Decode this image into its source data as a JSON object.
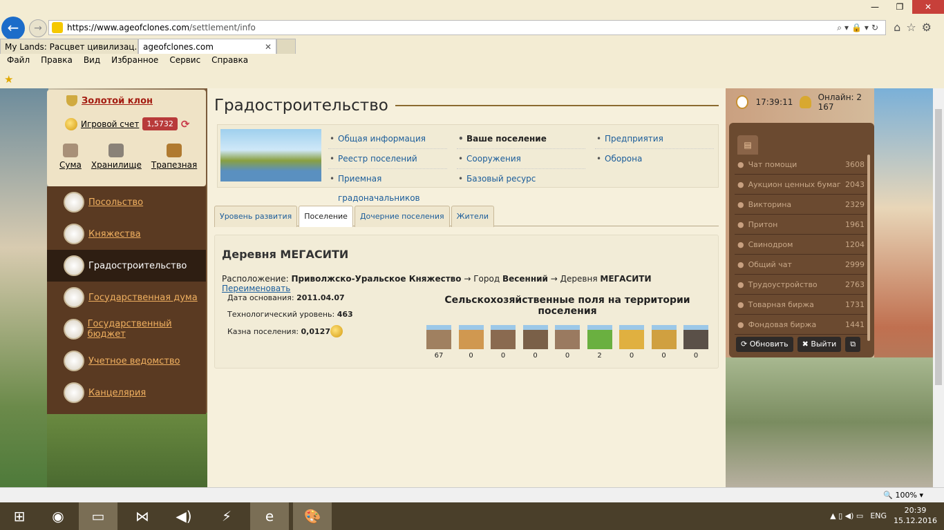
{
  "browser": {
    "url_host": "https://www.ageofclones.com",
    "url_path": "/settlement/info",
    "tabs": [
      {
        "label": "My Lands: Расцвет цивилизац..."
      },
      {
        "label": "ageofclones.com"
      }
    ],
    "menu": [
      "Файл",
      "Правка",
      "Вид",
      "Избранное",
      "Сервис",
      "Справка"
    ],
    "zoom": "100%"
  },
  "left": {
    "gold_clone": "Золотой клон",
    "account_label": "Игровой счет",
    "account_value": "1,5732",
    "quick": [
      {
        "label": "Сума"
      },
      {
        "label": "Хранилище"
      },
      {
        "label": "Трапезная"
      }
    ],
    "nav": [
      {
        "label": "Посольство"
      },
      {
        "label": "Княжества"
      },
      {
        "label": "Градостроительство",
        "active": true
      },
      {
        "label": "Государственная дума"
      },
      {
        "label": "Государственный бюджет"
      },
      {
        "label": "Учетное ведомство"
      },
      {
        "label": "Канцелярия"
      }
    ]
  },
  "main": {
    "title": "Градостроительство",
    "links": [
      [
        "Общая информация",
        "Реестр поселений",
        "Приемная градоначальников"
      ],
      [
        "Ваше поселение",
        "Сооружения",
        "Базовый ресурс"
      ],
      [
        "Предприятия",
        "Оборона"
      ]
    ],
    "tabs": [
      "Уровень развития",
      "Поселение",
      "Дочерние поселения",
      "Жители"
    ],
    "active_tab": "Поселение",
    "settlement": {
      "name": "Деревня МЕГАСИТИ",
      "loc_label": "Расположение:",
      "loc_principality": "Приволжско-Уральское Княжество",
      "arrow": "→",
      "city_prefix": "Город",
      "city": "Весенний",
      "village_prefix": "Деревня",
      "village": "МЕГАСИТИ",
      "rename": "Переименовать",
      "founded_label": "Дата основания:",
      "founded": "2011.04.07",
      "tech_label": "Технологический уровень:",
      "tech": "463",
      "treasury_label": "Казна поселения:",
      "treasury": "0,0127",
      "fields_title": "Сельскохозяйственные поля на территории поселения",
      "fields": [
        "67",
        "0",
        "0",
        "0",
        "0",
        "2",
        "0",
        "0",
        "0"
      ]
    }
  },
  "right": {
    "time": "17:39:11",
    "online": "Онлайн: 2 167",
    "chats": [
      {
        "name": "Чат помощи",
        "count": "3608"
      },
      {
        "name": "Аукцион ценных бумаг",
        "count": "2043"
      },
      {
        "name": "Викторина",
        "count": "2329"
      },
      {
        "name": "Притон",
        "count": "1961"
      },
      {
        "name": "Свинодром",
        "count": "1204"
      },
      {
        "name": "Общий чат",
        "count": "2999"
      },
      {
        "name": "Трудоустройство",
        "count": "2763"
      },
      {
        "name": "Товарная биржа",
        "count": "1731"
      },
      {
        "name": "Фондовая биржа",
        "count": "1441"
      }
    ],
    "refresh": "Обновить",
    "exit": "Выйти"
  },
  "taskbar": {
    "lang": "ENG",
    "time": "20:39",
    "date": "15.12.2016"
  }
}
